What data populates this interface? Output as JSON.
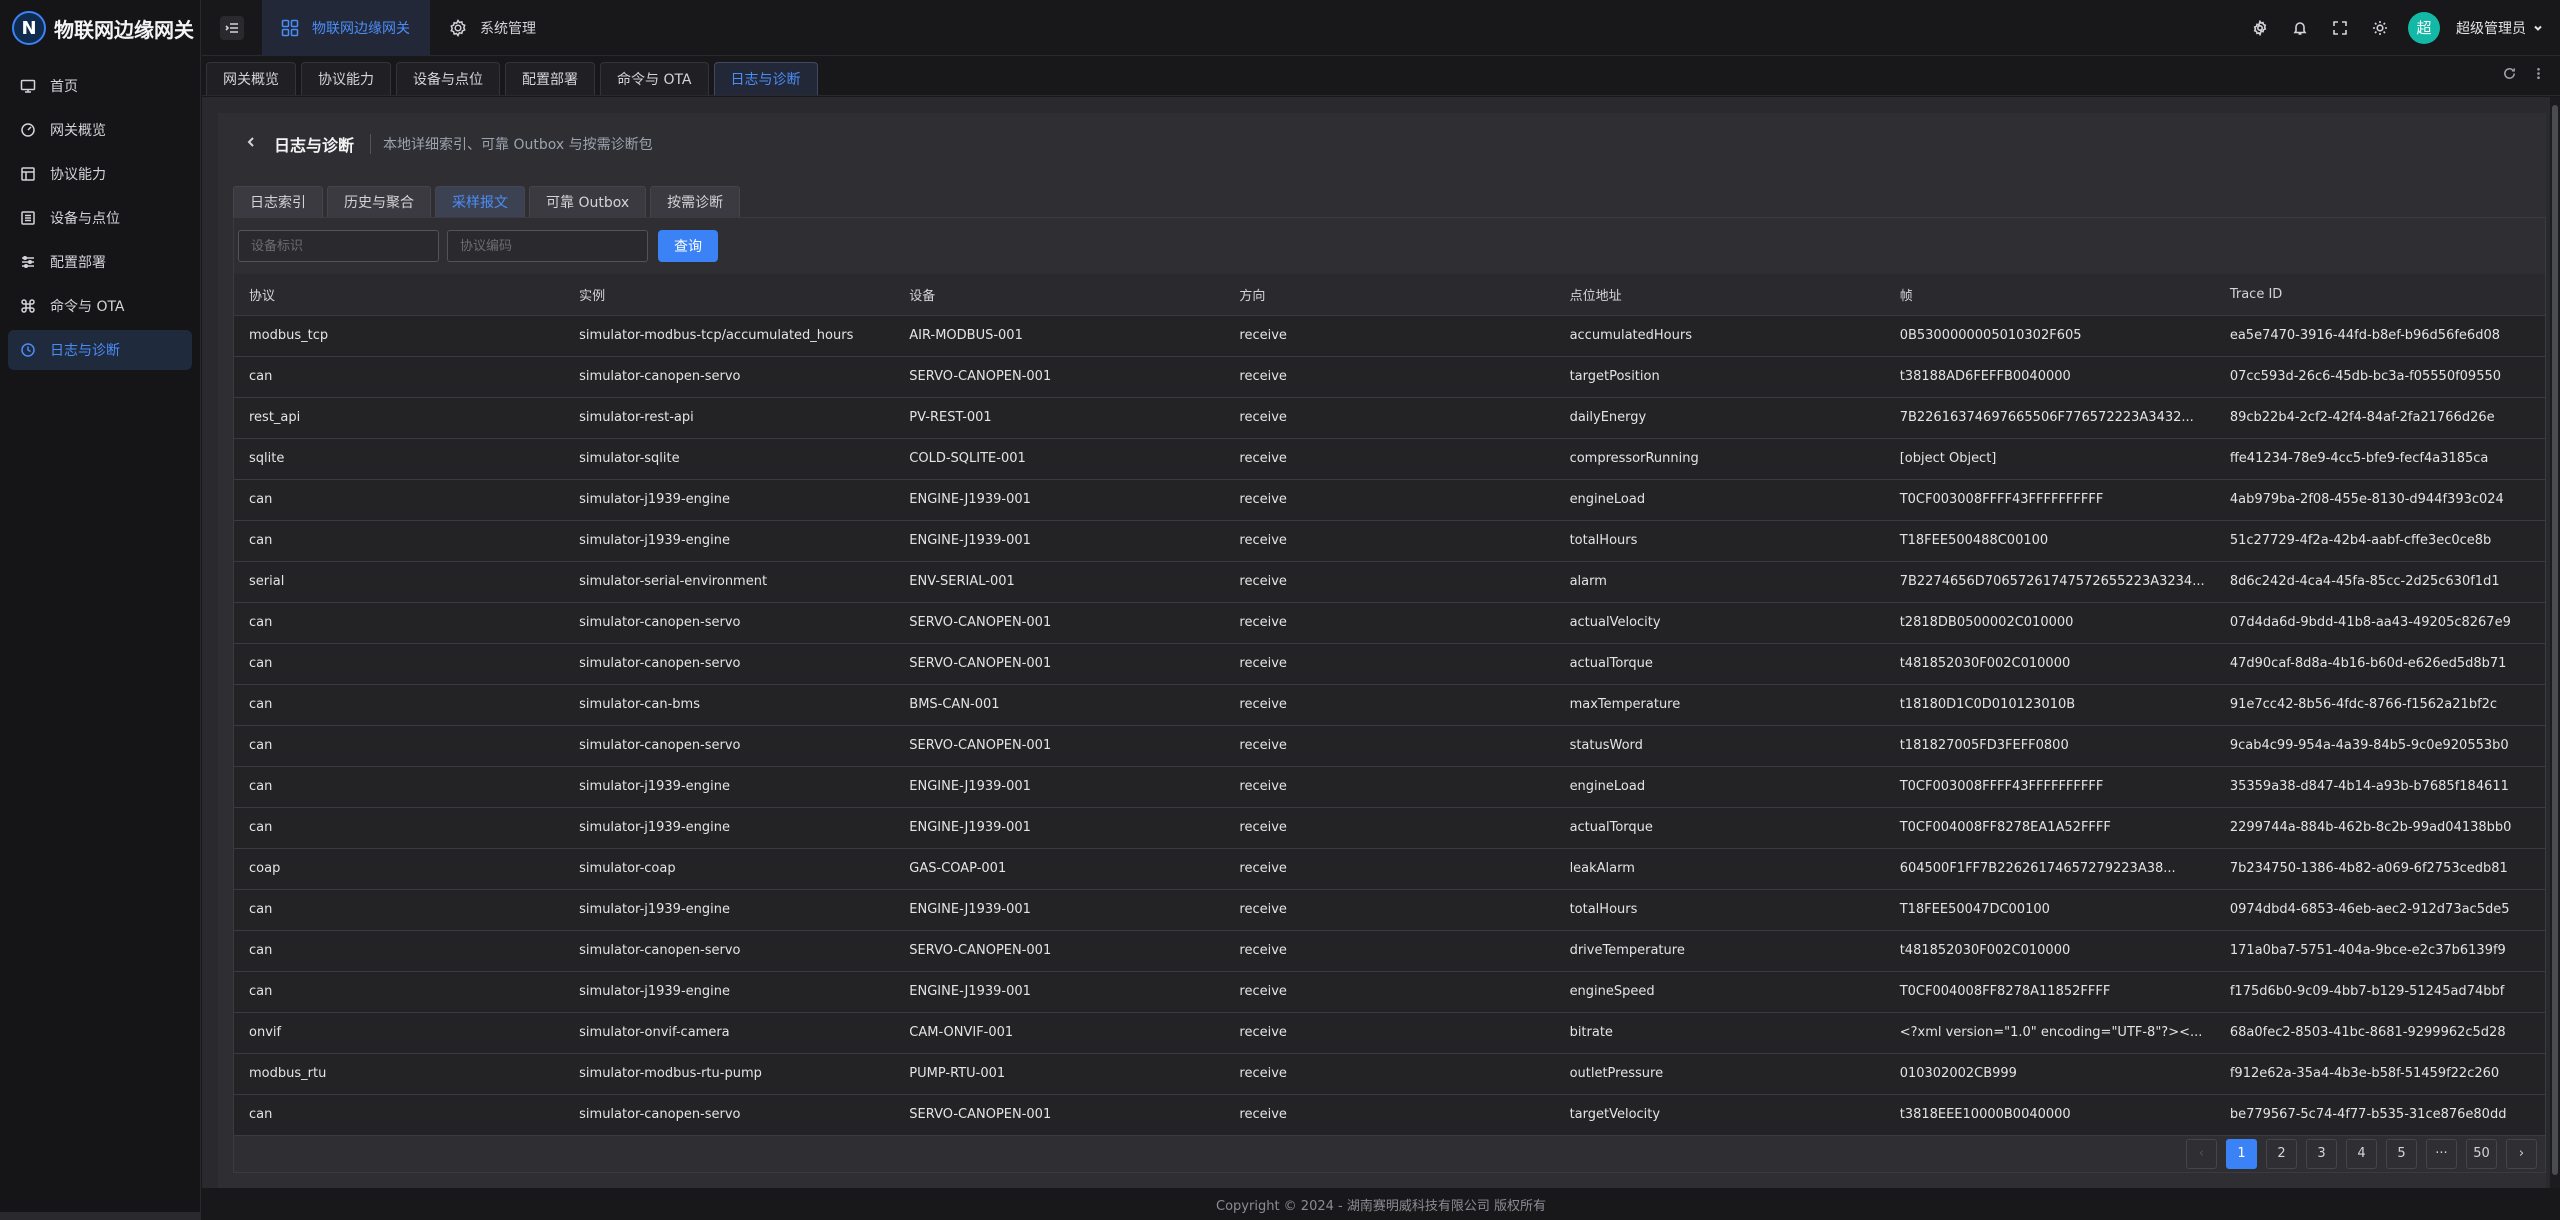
{
  "brand": {
    "logo_letter": "N",
    "title": "物联网边缘网关"
  },
  "sidebar": {
    "items": [
      {
        "label": "首页",
        "icon": "monitor-icon"
      },
      {
        "label": "网关概览",
        "icon": "dashboard-icon"
      },
      {
        "label": "协议能力",
        "icon": "layout-icon"
      },
      {
        "label": "设备与点位",
        "icon": "list-icon"
      },
      {
        "label": "配置部署",
        "icon": "sliders-icon"
      },
      {
        "label": "命令与 OTA",
        "icon": "command-icon"
      },
      {
        "label": "日志与诊断",
        "icon": "clock-icon"
      }
    ],
    "active_index": 6
  },
  "header": {
    "nav": [
      {
        "label": "物联网边缘网关",
        "icon": "grid-icon"
      },
      {
        "label": "系统管理",
        "icon": "gear-icon"
      }
    ],
    "user": {
      "avatar_text": "超",
      "name": "超级管理员"
    }
  },
  "tabs": [
    "网关概览",
    "协议能力",
    "设备与点位",
    "配置部署",
    "命令与 OTA",
    "日志与诊断"
  ],
  "page": {
    "title": "日志与诊断",
    "subtitle": "本地详细索引、可靠 Outbox 与按需诊断包",
    "subtabs": [
      "日志索引",
      "历史与聚合",
      "采样报文",
      "可靠 Outbox",
      "按需诊断"
    ],
    "active_subtab": 2
  },
  "filters": {
    "device_placeholder": "设备标识",
    "protocol_placeholder": "协议编码",
    "query_label": "查询"
  },
  "table": {
    "columns": [
      "协议",
      "实例",
      "设备",
      "方向",
      "点位地址",
      "帧",
      "Trace ID"
    ],
    "rows": [
      [
        "modbus_tcp",
        "simulator-modbus-tcp/accumulated_hours",
        "AIR-MODBUS-001",
        "receive",
        "accumulatedHours",
        "0B5300000005010302F605",
        "ea5e7470-3916-44fd-b8ef-b96d56fe6d08"
      ],
      [
        "can",
        "simulator-canopen-servo",
        "SERVO-CANOPEN-001",
        "receive",
        "targetPosition",
        "t38188AD6FEFFB0040000",
        "07cc593d-26c6-45db-bc3a-f05550f09550"
      ],
      [
        "rest_api",
        "simulator-rest-api",
        "PV-REST-001",
        "receive",
        "dailyEnergy",
        "7B22616374697665506F776572223A3432...",
        "89cb22b4-2cf2-42f4-84af-2fa21766d26e"
      ],
      [
        "sqlite",
        "simulator-sqlite",
        "COLD-SQLITE-001",
        "receive",
        "compressorRunning",
        "[object Object]",
        "ffe41234-78e9-4cc5-bfe9-fecf4a3185ca"
      ],
      [
        "can",
        "simulator-j1939-engine",
        "ENGINE-J1939-001",
        "receive",
        "engineLoad",
        "T0CF003008FFFF43FFFFFFFFFF",
        "4ab979ba-2f08-455e-8130-d944f393c024"
      ],
      [
        "can",
        "simulator-j1939-engine",
        "ENGINE-J1939-001",
        "receive",
        "totalHours",
        "T18FEE500488C00100",
        "51c27729-4f2a-42b4-aabf-cffe3ec0ce8b"
      ],
      [
        "serial",
        "simulator-serial-environment",
        "ENV-SERIAL-001",
        "receive",
        "alarm",
        "7B2274656D70657261747572655223A3234...",
        "8d6c242d-4ca4-45fa-85cc-2d25c630f1d1"
      ],
      [
        "can",
        "simulator-canopen-servo",
        "SERVO-CANOPEN-001",
        "receive",
        "actualVelocity",
        "t2818DB0500002C010000",
        "07d4da6d-9bdd-41b8-aa43-49205c8267e9"
      ],
      [
        "can",
        "simulator-canopen-servo",
        "SERVO-CANOPEN-001",
        "receive",
        "actualTorque",
        "t481852030F002C010000",
        "47d90caf-8d8a-4b16-b60d-e626ed5d8b71"
      ],
      [
        "can",
        "simulator-can-bms",
        "BMS-CAN-001",
        "receive",
        "maxTemperature",
        "t18180D1C0D010123010B",
        "91e7cc42-8b56-4fdc-8766-f1562a21bf2c"
      ],
      [
        "can",
        "simulator-canopen-servo",
        "SERVO-CANOPEN-001",
        "receive",
        "statusWord",
        "t181827005FD3FEFF0800",
        "9cab4c99-954a-4a39-84b5-9c0e920553b0"
      ],
      [
        "can",
        "simulator-j1939-engine",
        "ENGINE-J1939-001",
        "receive",
        "engineLoad",
        "T0CF003008FFFF43FFFFFFFFFF",
        "35359a38-d847-4b14-a93b-b7685f184611"
      ],
      [
        "can",
        "simulator-j1939-engine",
        "ENGINE-J1939-001",
        "receive",
        "actualTorque",
        "T0CF004008FF8278EA1A52FFFF",
        "2299744a-884b-462b-8c2b-99ad04138bb0"
      ],
      [
        "coap",
        "simulator-coap",
        "GAS-COAP-001",
        "receive",
        "leakAlarm",
        "604500F1FF7B22626174657279223A38...",
        "7b234750-1386-4b82-a069-6f2753cedb81"
      ],
      [
        "can",
        "simulator-j1939-engine",
        "ENGINE-J1939-001",
        "receive",
        "totalHours",
        "T18FEE50047DC00100",
        "0974dbd4-6853-46eb-aec2-912d73ac5de5"
      ],
      [
        "can",
        "simulator-canopen-servo",
        "SERVO-CANOPEN-001",
        "receive",
        "driveTemperature",
        "t481852030F002C010000",
        "171a0ba7-5751-404a-9bce-e2c37b6139f9"
      ],
      [
        "can",
        "simulator-j1939-engine",
        "ENGINE-J1939-001",
        "receive",
        "engineSpeed",
        "T0CF004008FF8278A11852FFFF",
        "f175d6b0-9c09-4bb7-b129-51245ad74bbf"
      ],
      [
        "onvif",
        "simulator-onvif-camera",
        "CAM-ONVIF-001",
        "receive",
        "bitrate",
        "<?xml version=\"1.0\" encoding=\"UTF-8\"?><...",
        "68a0fec2-8503-41bc-8681-9299962c5d28"
      ],
      [
        "modbus_rtu",
        "simulator-modbus-rtu-pump",
        "PUMP-RTU-001",
        "receive",
        "outletPressure",
        "010302002CB999",
        "f912e62a-35a4-4b3e-b58f-51459f22c260"
      ],
      [
        "can",
        "simulator-canopen-servo",
        "SERVO-CANOPEN-001",
        "receive",
        "targetVelocity",
        "t3818EEE10000B0040000",
        "be779567-5c74-4f77-b535-31ce876e80dd"
      ]
    ]
  },
  "pagination": {
    "prev": "‹",
    "pages": [
      "1",
      "2",
      "3",
      "4",
      "5",
      "···",
      "50"
    ],
    "next": "›",
    "current": "1"
  },
  "footer": {
    "copyright": "Copyright © 2024 - 湖南赛明威科技有限公司 版权所有"
  },
  "colors": {
    "accent": "#3b82f6",
    "active_text": "#4b8df8",
    "avatar": "#14b8a6"
  }
}
